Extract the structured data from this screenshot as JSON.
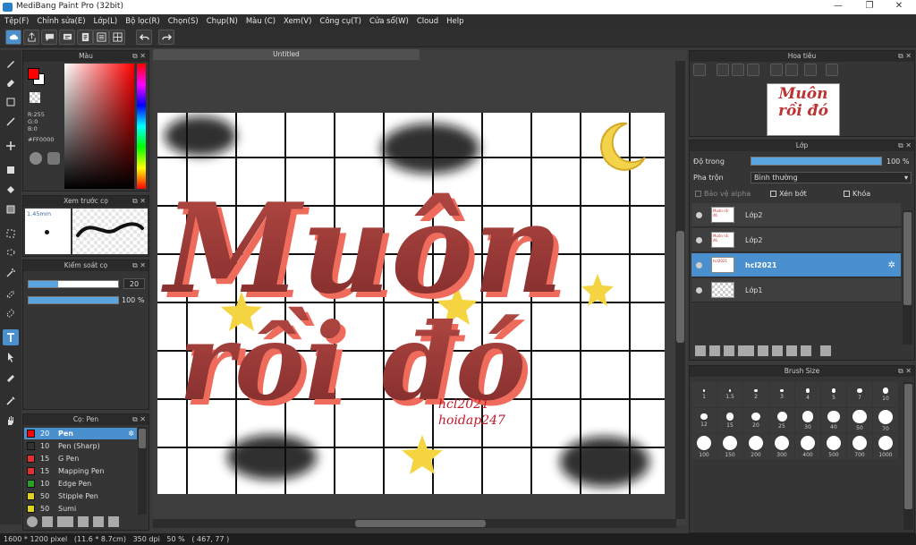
{
  "window": {
    "title": "MediBang Paint Pro (32bit)",
    "min": "—",
    "restore": "❐",
    "close": "✕"
  },
  "menu": [
    "Tệp(F)",
    "Chỉnh sửa(E)",
    "Lớp(L)",
    "Bộ lọc(R)",
    "Chọn(S)",
    "Chụp(N)",
    "Màu (C)",
    "Xem(V)",
    "Công cụ(T)",
    "Cửa sổ(W)",
    "Cloud",
    "Help"
  ],
  "color_panel": {
    "title": "Màu",
    "r": "R:255",
    "g": "G:0",
    "b": "B:0",
    "hex": "#FF0000",
    "fg": "#ff0000",
    "bg": "#ffffff"
  },
  "brush_preview": {
    "title": "Xem trước cọ",
    "size": "1.45mm"
  },
  "brush_control": {
    "title": "Kiểm soát cọ",
    "size": "20",
    "opacity": "100 %",
    "size_fraction": 0.33,
    "opacity_fraction": 1.0
  },
  "brush_list": {
    "title": "Cọ: Pen",
    "items": [
      {
        "size": "20",
        "name": "Pen",
        "color": "#ff0000",
        "selected": true
      },
      {
        "size": "10",
        "name": "Pen (Sharp)",
        "color": "#333333"
      },
      {
        "size": "15",
        "name": "G Pen",
        "color": "#e03030"
      },
      {
        "size": "15",
        "name": "Mapping Pen",
        "color": "#e03030"
      },
      {
        "size": "10",
        "name": "Edge Pen",
        "color": "#2aa02a"
      },
      {
        "size": "50",
        "name": "Stipple Pen",
        "color": "#e0d020"
      },
      {
        "size": "50",
        "name": "Sumi",
        "color": "#e0d020"
      }
    ]
  },
  "canvas": {
    "tab": "Untitled",
    "art_line1": "Muôn",
    "art_line2": "rồi đó",
    "watermark1": "hcl2021",
    "watermark2": "hoidap247"
  },
  "navigator": {
    "title": "Hoa tiêu",
    "thumb_line1": "Muôn",
    "thumb_line2": "rồi đó"
  },
  "layers": {
    "title": "Lớp",
    "opacity_label": "Độ trong",
    "opacity_value": "100 %",
    "opacity_fraction": 1.0,
    "blend_label": "Pha trộn",
    "blend_value": "Bình thường",
    "protect_alpha": "Bảo vệ alpha",
    "clipping": "Xén bớt",
    "lock": "Khóa",
    "items": [
      {
        "name": "Lớp2",
        "thumb": "Muôn rồi đó"
      },
      {
        "name": "Lớp2",
        "thumb": "Muôn rồi đó"
      },
      {
        "name": "hcl2021",
        "thumb": "hcl2021",
        "selected": true
      },
      {
        "name": "Lớp1",
        "thumb": ""
      }
    ]
  },
  "brush_size": {
    "title": "Brush Size",
    "sizes": [
      "1",
      "1.5",
      "2",
      "3",
      "4",
      "5",
      "7",
      "10",
      "12",
      "15",
      "20",
      "25",
      "30",
      "40",
      "50",
      "70",
      "100",
      "150",
      "200",
      "300",
      "400",
      "500",
      "700",
      "1000"
    ]
  },
  "status": "1600 * 1200 pixel   (11.6 * 8.7cm)   350 dpi   50 %   ( 467, 77 )"
}
